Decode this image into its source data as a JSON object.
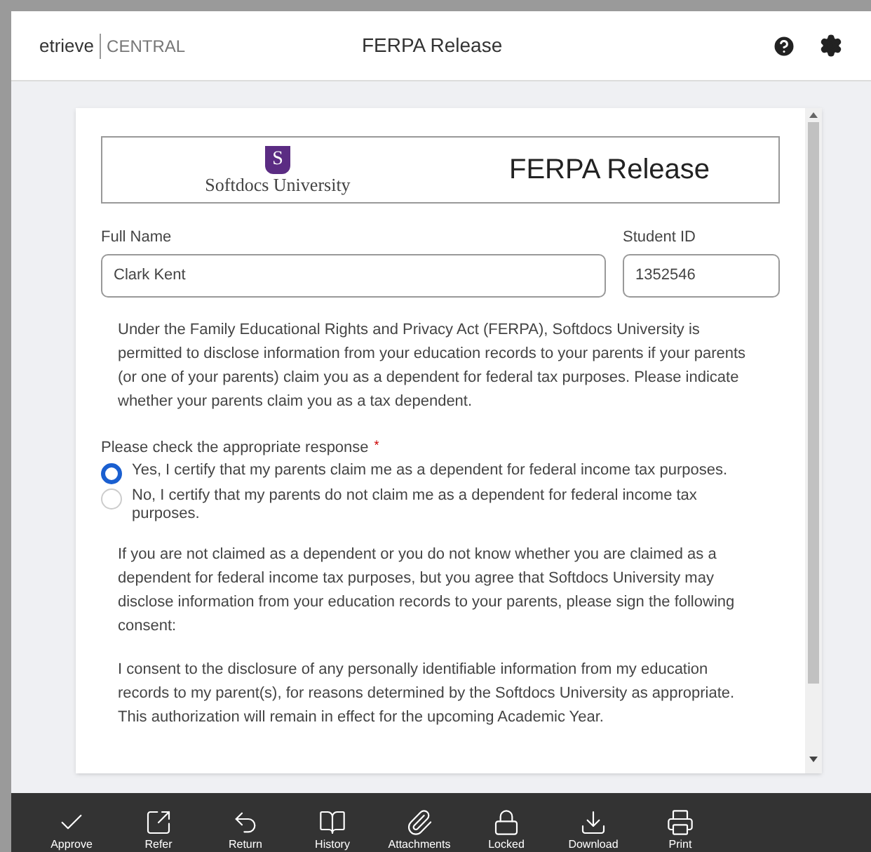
{
  "app": {
    "brand": "etrieve",
    "product": "CENTRAL",
    "title": "FERPA Release"
  },
  "form": {
    "logo_text": "Softdocs University",
    "logo_letter": "S",
    "heading": "FERPA Release",
    "fields": [
      {
        "label": "Full Name",
        "value": "Clark Kent"
      },
      {
        "label": "Student ID",
        "value": "1352546"
      }
    ],
    "intro": "Under the Family Educational Rights and Privacy Act (FERPA), Softdocs University is permitted to disclose information from your education records to your parents if your parents (or one of your parents) claim you as a dependent for federal tax purposes. Please indicate whether your parents claim you as a tax dependent.",
    "question": "Please check the appropriate response",
    "required_mark": "*",
    "options": [
      {
        "label": "Yes, I certify that my parents claim me as a dependent for federal income tax purposes.",
        "selected": true
      },
      {
        "label": "No, I certify that my parents do not claim me as a dependent for federal income tax purposes.",
        "selected": false
      }
    ],
    "paragraphs": [
      "If you are not claimed as a dependent or you do not know whether you are claimed as a dependent for federal income tax purposes, but you agree that Softdocs University may disclose information from your education records to your parents, please sign the following consent:",
      "I consent to the disclosure of any personally identifiable information from my education records to my parent(s), for reasons determined by the Softdocs University as appropriate. This authorization will remain in effect for the upcoming Academic Year."
    ]
  },
  "toolbar": [
    {
      "kind": "approve",
      "label": "Approve"
    },
    {
      "kind": "refer",
      "label": "Refer"
    },
    {
      "kind": "return",
      "label": "Return"
    },
    {
      "kind": "history",
      "label": "History"
    },
    {
      "kind": "attachments",
      "label": "Attachments"
    },
    {
      "kind": "locked",
      "label": "Locked"
    },
    {
      "kind": "download",
      "label": "Download"
    },
    {
      "kind": "print",
      "label": "Print"
    }
  ]
}
